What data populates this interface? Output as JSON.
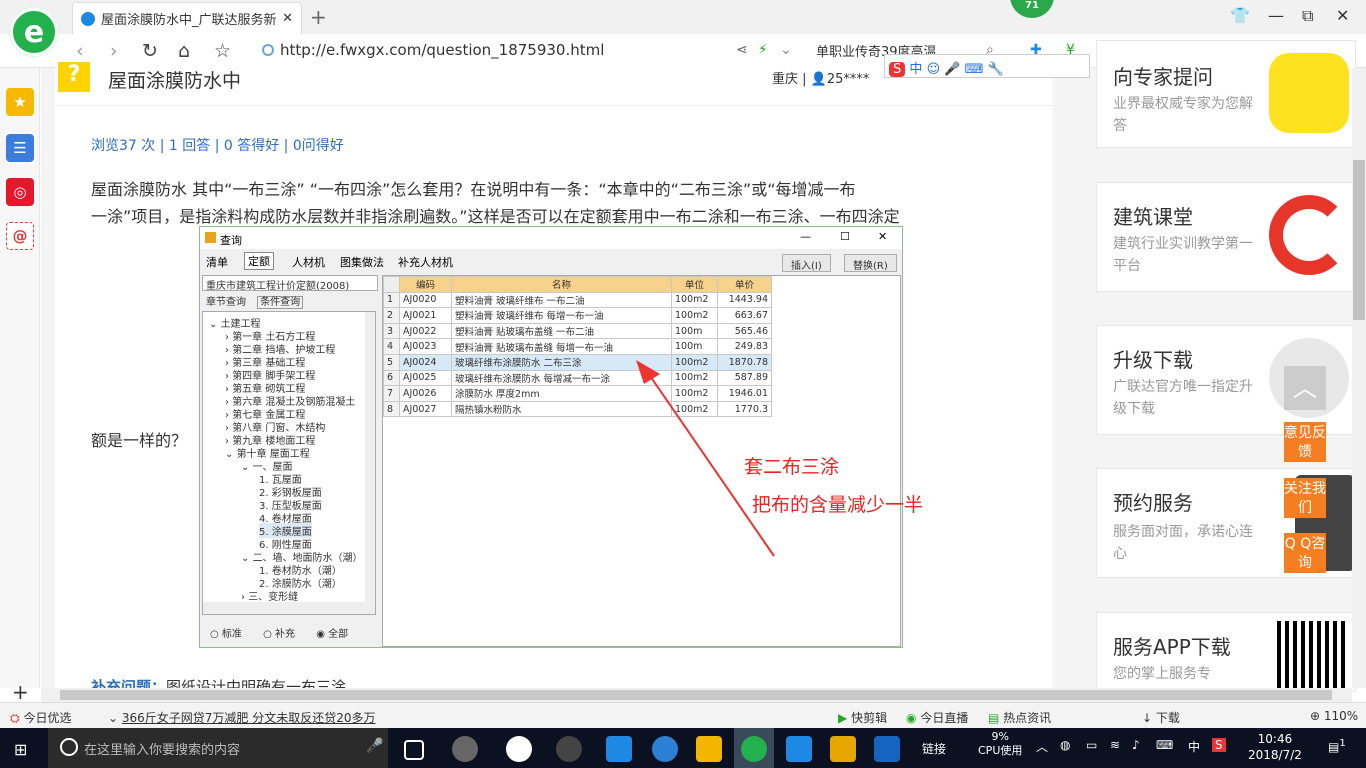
{
  "browser": {
    "tab_title": "屋面涂膜防水中_广联达服务新干",
    "new_tab": "+",
    "badge": "71",
    "url": "http://e.fwxgx.com/question_1875930.html",
    "search_text": "单职业传奇39度高温",
    "win": {
      "restore": "⧉",
      "min": "—",
      "max": "▢",
      "close": "✕"
    }
  },
  "question": {
    "title": "屋面涂膜防水中",
    "location": "重庆 | 👤25****",
    "stats": "浏览37 次 | 1 回答 | 0 答得好 | 0问得好",
    "line1": "屋面涂膜防水 其中“一布三涂” “一布四涂”怎么套用？在说明中有一条：“本章中的“二布三涂”或“每增减一布",
    "line2": "一涂”项目，是指涂料构成防水层数并非指涂刷遍数。”这样是否可以在定额套用中一布二涂和一布三涂、一布四涂定",
    "line3": "额是一样的？",
    "supp_label": "补充问题：",
    "supp_text": "图纸设计中明确有一布三涂"
  },
  "right_cards": [
    {
      "title": "向专家提问",
      "sub": "业界最权威专家为您解答"
    },
    {
      "title": "建筑课堂",
      "sub": "建筑行业实训教学第一平台"
    },
    {
      "title": "升级下载",
      "sub": "广联达官方唯一指定升级下载"
    },
    {
      "title": "预约服务",
      "sub": "服务面对面，承诺心连心"
    },
    {
      "title": "服务APP下载",
      "sub": "您的掌上服务专"
    }
  ],
  "float_buttons": {
    "feedback": "意见反馈",
    "follow": "关注我们",
    "qq": "Q Q咨询",
    "top": "︿"
  },
  "dialog": {
    "title": "查询",
    "menu": [
      "清单",
      "定额",
      "人材机",
      "图集做法",
      "补充人材机"
    ],
    "insert": "插入(I)",
    "replace": "替换(R)",
    "dropdown": "重庆市建筑工程计价定额(2008)",
    "tabs": [
      "章节查询",
      "条件查询"
    ],
    "tree": [
      "土建工程",
      "第一章 土石方工程",
      "第二章 挡墙、护坡工程",
      "第三章 基础工程",
      "第四章 脚手架工程",
      "第五章 砌筑工程",
      "第六章 混凝土及钢筋混凝土",
      "第七章 金属工程",
      "第八章 门窗、木结构",
      "第九章 楼地面工程",
      "第十章 屋面工程",
      "一、屋面",
      "1. 瓦屋面",
      "2. 彩钢板屋面",
      "3. 压型板屋面",
      "4. 卷材屋面",
      "5. 涂膜屋面",
      "6. 刚性屋面",
      "二、墙、地面防水（潮）",
      "1. 卷材防水（潮）",
      "2. 涂膜防水（潮）",
      "三、变形缝"
    ],
    "radios": [
      "标准",
      "补充",
      "全部"
    ],
    "columns": [
      "",
      "编码",
      "名称",
      "单位",
      "单价"
    ],
    "rows": [
      [
        "1",
        "AJ0020",
        "塑料油膏 玻璃纤维布 一布二油",
        "100m2",
        "1443.94"
      ],
      [
        "2",
        "AJ0021",
        "塑料油膏 玻璃纤维布 每增一布一油",
        "100m2",
        "663.67"
      ],
      [
        "3",
        "AJ0022",
        "塑料油膏 贴玻璃布盖缝 一布二油",
        "100m",
        "565.46"
      ],
      [
        "4",
        "AJ0023",
        "塑料油膏 贴玻璃布盖缝 每增一布一油",
        "100m",
        "249.83"
      ],
      [
        "5",
        "AJ0024",
        "玻璃纤维布涂膜防水 二布三涂",
        "100m2",
        "1870.78"
      ],
      [
        "6",
        "AJ0025",
        "玻璃纤维布涂膜防水 每增减一布一涂",
        "100m2",
        "587.89"
      ],
      [
        "7",
        "AJ0026",
        "涂膜防水 厚度2mm",
        "100m2",
        "1946.01"
      ],
      [
        "8",
        "AJ0027",
        "隔热镇水粉防水",
        "100m2",
        "1770.3"
      ]
    ],
    "selected_row": 4
  },
  "annotations": {
    "a1": "套二布三涂",
    "a2": "把布的含量减少一半"
  },
  "statusbar": {
    "s1": "今日优选",
    "s2": "366斤女子网贷7万减肥 分文未取反还贷20多万",
    "s3": "快剪辑",
    "s4": "今日直播",
    "s5": "热点资讯",
    "s6": "下载",
    "s7": "110%"
  },
  "taskbar": {
    "search": "在这里输入你要搜索的内容",
    "link": "链接",
    "cpu": "9%",
    "cpu_label": "CPU使用",
    "ime": "中",
    "time": "10:46",
    "date": "2018/7/2",
    "notif": "1"
  }
}
